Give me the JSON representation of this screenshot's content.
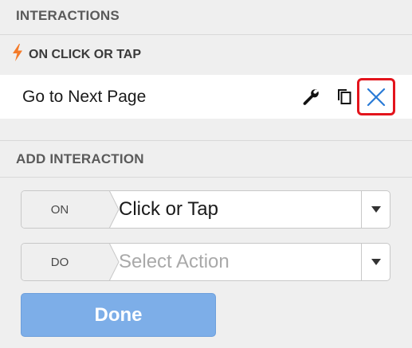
{
  "interactions_header": "INTERACTIONS",
  "event": {
    "label": "ON CLICK OR TAP",
    "icon": "lightning-bolt-icon",
    "icon_color": "#f47b2a"
  },
  "action": {
    "label": "Go to Next Page",
    "icons": [
      "wrench-icon",
      "copy-icon",
      "close-icon"
    ],
    "close_color": "#2a7bd6",
    "highlight_color": "#e3141c"
  },
  "add_interaction_header": "ADD INTERACTION",
  "on_select": {
    "tag": "ON",
    "value": "Click or Tap"
  },
  "do_select": {
    "tag": "DO",
    "placeholder": "Select Action"
  },
  "done_button": {
    "label": "Done",
    "color": "#7daee8"
  }
}
